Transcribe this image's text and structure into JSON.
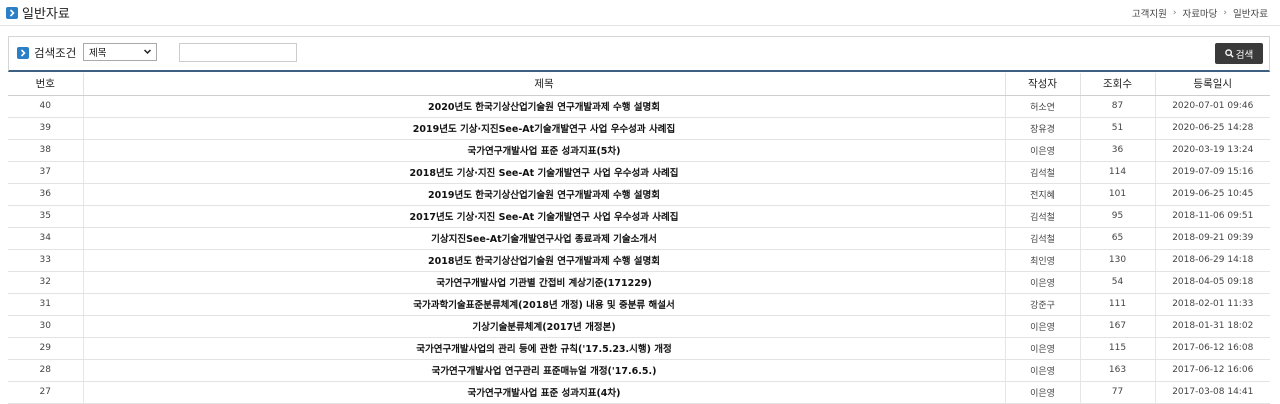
{
  "header": {
    "title": "일반자료",
    "breadcrumb": [
      "고객지원",
      "자료마당",
      "일반자료"
    ]
  },
  "search": {
    "label": "검색조건",
    "select_value": "제목",
    "input_value": "",
    "button_label": "검색"
  },
  "table": {
    "columns": [
      "번호",
      "제목",
      "작성자",
      "조회수",
      "등록일시"
    ],
    "rows": [
      {
        "no": "40",
        "title": "2020년도 한국기상산업기술원 연구개발과제 수행 설명회",
        "author": "허소연",
        "views": "87",
        "date": "2020-07-01 09:46"
      },
      {
        "no": "39",
        "title": "2019년도 기상·지진See-At기술개발연구 사업 우수성과 사례집",
        "author": "장유경",
        "views": "51",
        "date": "2020-06-25 14:28"
      },
      {
        "no": "38",
        "title": "국가연구개발사업 표준 성과지표(5차)",
        "author": "이은영",
        "views": "36",
        "date": "2020-03-19 13:24"
      },
      {
        "no": "37",
        "title": "2018년도 기상·지진 See-At 기술개발연구 사업 우수성과 사례집",
        "author": "김석철",
        "views": "114",
        "date": "2019-07-09 15:16"
      },
      {
        "no": "36",
        "title": "2019년도 한국기상산업기술원 연구개발과제 수행 설명회",
        "author": "전지혜",
        "views": "101",
        "date": "2019-06-25 10:45"
      },
      {
        "no": "35",
        "title": "2017년도 기상·지진 See-At 기술개발연구 사업 우수성과 사례집",
        "author": "김석철",
        "views": "95",
        "date": "2018-11-06 09:51"
      },
      {
        "no": "34",
        "title": "기상지진See-At기술개발연구사업 종료과제 기술소개서",
        "author": "김석철",
        "views": "65",
        "date": "2018-09-21 09:39"
      },
      {
        "no": "33",
        "title": "2018년도 한국기상산업기술원 연구개발과제 수행 설명회",
        "author": "최인영",
        "views": "130",
        "date": "2018-06-29 14:18"
      },
      {
        "no": "32",
        "title": "국가연구개발사업 기관별 간접비 계상기준(171229)",
        "author": "이은영",
        "views": "54",
        "date": "2018-04-05 09:18"
      },
      {
        "no": "31",
        "title": "국가과학기술표준분류체계(2018년 개정) 내용 및 중분류 해설서",
        "author": "강준구",
        "views": "111",
        "date": "2018-02-01 11:33"
      },
      {
        "no": "30",
        "title": "기상기술분류체계(2017년 개정본)",
        "author": "이은영",
        "views": "167",
        "date": "2018-01-31 18:02"
      },
      {
        "no": "29",
        "title": "국가연구개발사업의 관리 등에 관한 규칙('17.5.23.시행) 개정",
        "author": "이은영",
        "views": "115",
        "date": "2017-06-12 16:08"
      },
      {
        "no": "28",
        "title": "국가연구개발사업 연구관리 표준매뉴얼 개정('17.6.5.)",
        "author": "이은영",
        "views": "163",
        "date": "2017-06-12 16:06"
      },
      {
        "no": "27",
        "title": "국가연구개발사업 표준 성과지표(4차)",
        "author": "이은영",
        "views": "77",
        "date": "2017-03-08 14:41"
      }
    ]
  },
  "colors": {
    "accent_blue": "#2a7fc7",
    "header_underline": "#3d5f82",
    "button_dark": "#3a3a3a"
  }
}
